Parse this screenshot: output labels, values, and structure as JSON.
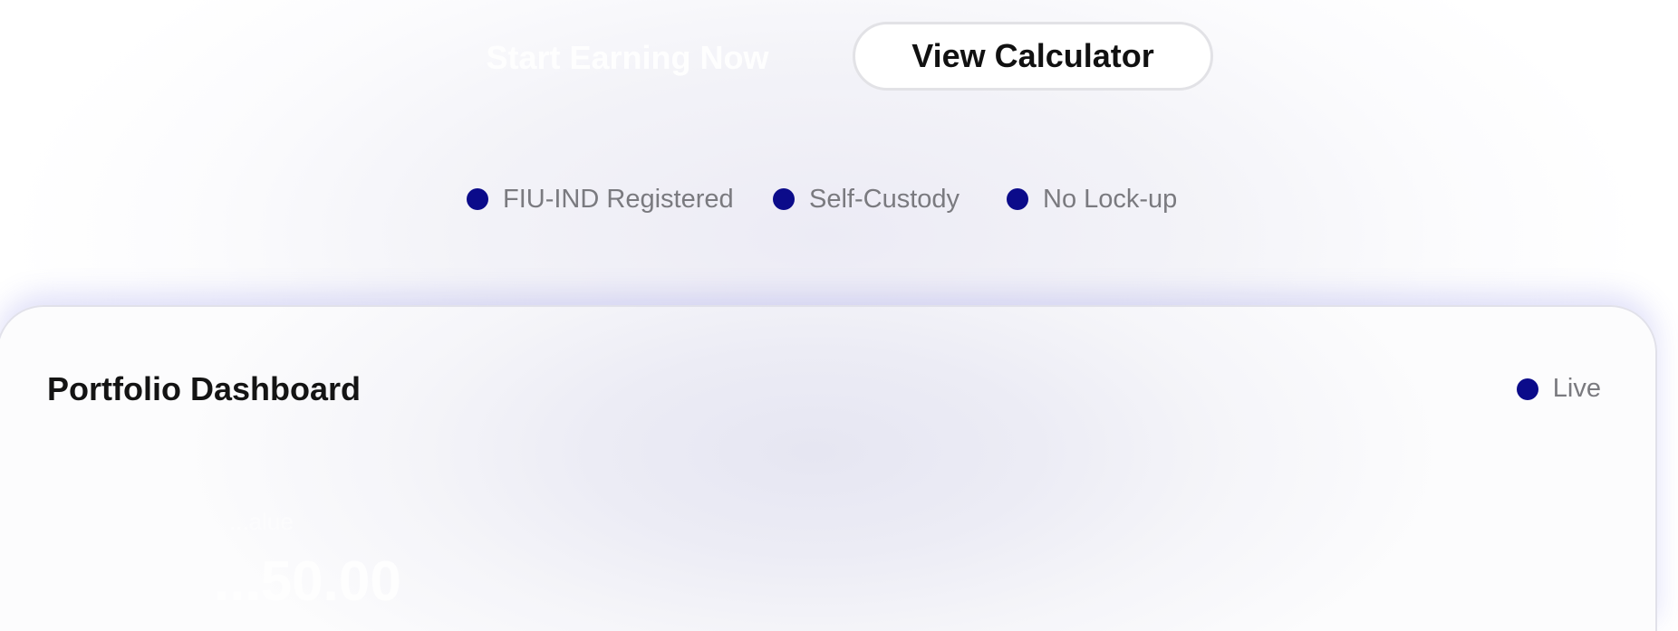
{
  "cta": {
    "primary_label": "Start Earning Now",
    "secondary_label": "View Calculator"
  },
  "badges": [
    {
      "label": "FIU-IND Registered"
    },
    {
      "label": "Self-Custody"
    },
    {
      "label": "No Lock-up"
    }
  ],
  "dashboard": {
    "title": "Portfolio Dashboard",
    "status": "Live",
    "balance_label": "...alue",
    "balance_value": "...50.00"
  },
  "colors": {
    "accent_dot": "#0b0b8a",
    "text_muted": "#7a7a7f",
    "text_dark": "#141414"
  }
}
